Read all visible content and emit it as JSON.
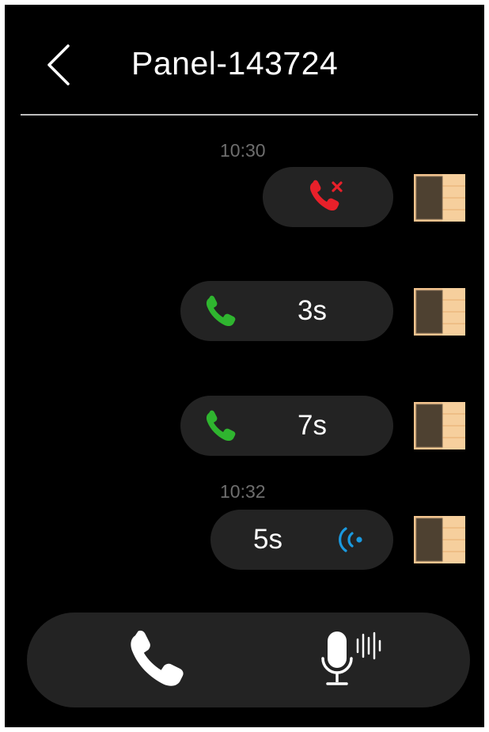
{
  "header": {
    "title": "Panel-143724"
  },
  "messages": [
    {
      "timestamp": "10:30",
      "type": "missed-call",
      "duration": ""
    },
    {
      "timestamp": "",
      "type": "call",
      "duration": "3s"
    },
    {
      "timestamp": "",
      "type": "call",
      "duration": "7s"
    },
    {
      "timestamp": "10:32",
      "type": "voice-message",
      "duration": "5s"
    }
  ],
  "icons": {
    "back": "chevron-left-icon",
    "missed_call": "missed-call-icon",
    "call": "phone-icon",
    "voice": "voice-wave-icon",
    "avatar": "panel-device-icon",
    "microphone": "microphone-icon"
  },
  "colors": {
    "background": "#000000",
    "bubble": "#232323",
    "missed_call": "#e8202a",
    "call": "#2fb52f",
    "voice": "#1a9ae0",
    "timestamp": "#6e6e6e"
  }
}
